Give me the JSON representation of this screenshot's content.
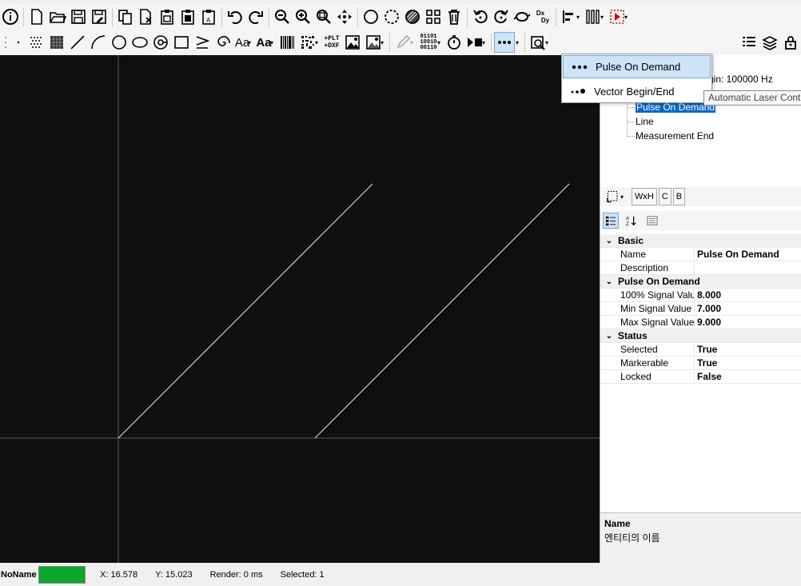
{
  "toolbar1": {
    "icons": [
      "info-icon",
      "new-file-icon",
      "open-folder-icon",
      "save-icon",
      "save-as-icon",
      "copy-icon",
      "cut-icon",
      "paste-icon",
      "paste-special-icon",
      "paste-in-place-icon",
      "undo-icon",
      "redo-icon",
      "zoom-out-icon",
      "zoom-in-icon",
      "zoom-fit-icon",
      "pan-icon",
      "circle-select-icon",
      "lasso-icon",
      "hatch-icon",
      "group-icon",
      "delete-icon",
      "rotate-ccw-icon",
      "rotate-cw-icon",
      "mirror-icon",
      "dxdy-icon",
      "align-icon",
      "distribute-icon",
      "marker-icon"
    ],
    "dxdy_label_top": "Dx",
    "dxdy_label_bottom": "Dy"
  },
  "toolbar2": {
    "text_label": "Aa",
    "text_bold_label": "Aa",
    "plt_label_top": "+PLT",
    "plt_label_bottom": "+DXF",
    "binary_label": [
      "01101",
      "10010",
      "00110"
    ]
  },
  "dropdown": {
    "items": [
      {
        "label": "Pulse On Demand"
      },
      {
        "label": "Vector Begin/End"
      }
    ]
  },
  "tooltip": "Automatic Laser Cont",
  "tree": {
    "items": [
      {
        "label": "Vector Begin: 100000 Hz"
      },
      {
        "label": "Pulse On Demand"
      },
      {
        "label": "Line"
      },
      {
        "label": "Measurement End"
      }
    ],
    "partial_label": "gin: 100000 Hz"
  },
  "prop_tabs": [
    "WxH",
    "C",
    "B"
  ],
  "properties": [
    {
      "category": "Basic",
      "rows": [
        {
          "name": "Name",
          "value": "Pulse On Demand"
        },
        {
          "name": "Description",
          "value": ""
        }
      ]
    },
    {
      "category": "Pulse On Demand",
      "rows": [
        {
          "name": "100% Signal Valu",
          "value": "8.000"
        },
        {
          "name": "Min Signal Value",
          "value": "7.000"
        },
        {
          "name": "Max Signal Value",
          "value": "9.000"
        }
      ]
    },
    {
      "category": "Status",
      "rows": [
        {
          "name": "Selected",
          "value": "True"
        },
        {
          "name": "Markerable",
          "value": "True"
        },
        {
          "name": "Locked",
          "value": "False"
        }
      ]
    }
  ],
  "description": {
    "title": "Name",
    "text": "엔티티의 이름"
  },
  "status": {
    "doc_name": "NoName",
    "color": "#0aa82a",
    "x": "X: 16.578",
    "y": "Y: 15.023",
    "render": "Render: 0 ms",
    "selected": "Selected: 1"
  }
}
